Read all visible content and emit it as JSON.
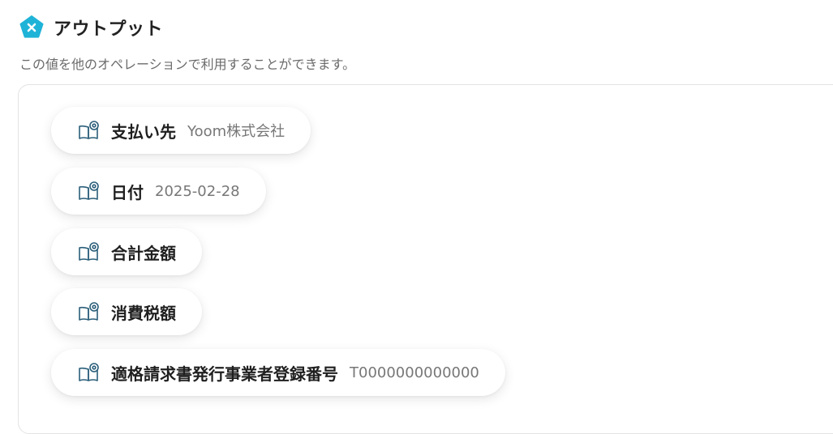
{
  "header": {
    "title": "アウトプット",
    "logo_icon": "x-pentagon-icon",
    "logo_color": "#1fb3d8"
  },
  "description": "この値を他のオペレーションで利用することができます。",
  "outputs": [
    {
      "label": "支払い先",
      "value": "Yoom株式会社",
      "icon": "book-eye-icon"
    },
    {
      "label": "日付",
      "value": "2025-02-28",
      "icon": "book-eye-icon"
    },
    {
      "label": "合計金額",
      "value": "",
      "icon": "book-eye-icon"
    },
    {
      "label": "消費税額",
      "value": "",
      "icon": "book-eye-icon"
    },
    {
      "label": "適格請求書発行事業者登録番号",
      "value": "T0000000000000",
      "icon": "book-eye-icon"
    }
  ],
  "colors": {
    "icon_stroke": "#2a5e79",
    "accent": "#1fb3d8"
  }
}
